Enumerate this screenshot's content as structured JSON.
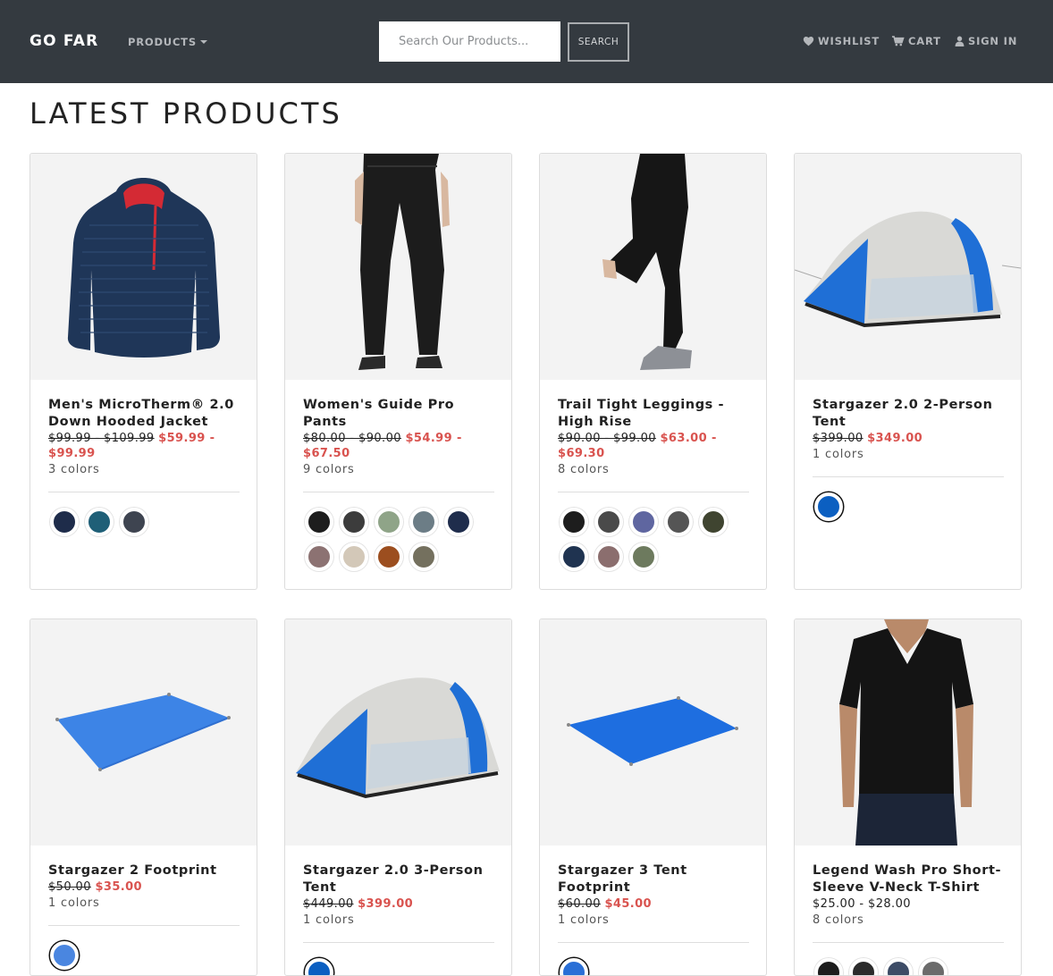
{
  "nav": {
    "brand": "GO FAR",
    "products_label": "PRODUCTS",
    "search_placeholder": "Search Our Products...",
    "search_button": "SEARCH",
    "wishlist": "WISHLIST",
    "cart": "CART",
    "sign_in": "SIGN IN",
    "icons": [
      "heart-icon",
      "cart-icon",
      "user-icon",
      "caret-down-icon"
    ]
  },
  "page_title": "LATEST PRODUCTS",
  "colors": {
    "navbar": "#343a40",
    "sale_price": "#d9534f"
  },
  "products": [
    {
      "title": "Men's MicroTherm® 2.0 Down Hooded Jacket",
      "old_price": "$99.99 - $109.99",
      "price": "$59.99 - $99.99",
      "on_sale": true,
      "colors_label": "3 colors",
      "swatches": [
        "#1e2c4a",
        "#1f5f77",
        "#3e4450"
      ]
    },
    {
      "title": "Women's Guide Pro Pants",
      "old_price": "$80.00 - $90.00",
      "price": "$54.99 - $67.50",
      "on_sale": true,
      "colors_label": "9 colors",
      "swatches": [
        "#1d1d1d",
        "#3c3c3c",
        "#8fa488",
        "#6c7d86",
        "#1f2d4c",
        "#8c7272",
        "#d3c8b8",
        "#9c4e1f",
        "#74705e"
      ]
    },
    {
      "title": "Trail Tight Leggings - High Rise",
      "old_price": "$90.00 - $99.00",
      "price": "$63.00 - $69.30",
      "on_sale": true,
      "colors_label": "8 colors",
      "swatches": [
        "#1d1d1d",
        "#4a4a4a",
        "#5f66a0",
        "#555555",
        "#3f4430",
        "#1f3350",
        "#8b6e6e",
        "#6d7a5e"
      ]
    },
    {
      "title": "Stargazer 2.0 2-Person Tent",
      "old_price": "$399.00",
      "price": "$349.00",
      "on_sale": true,
      "colors_label": "1 colors",
      "swatches": [
        "#0b5fc1"
      ]
    },
    {
      "title": "Stargazer 2 Footprint",
      "old_price": "$50.00",
      "price": "$35.00",
      "on_sale": true,
      "colors_label": "1 colors",
      "swatches": [
        "#4a86e0"
      ]
    },
    {
      "title": "Stargazer 2.0 3-Person Tent",
      "old_price": "$449.00",
      "price": "$399.00",
      "on_sale": true,
      "colors_label": "1 colors",
      "swatches": [
        "#0b5fc1"
      ]
    },
    {
      "title": "Stargazer 3 Tent Footprint",
      "old_price": "$60.00",
      "price": "$45.00",
      "on_sale": true,
      "colors_label": "1 colors",
      "swatches": [
        "#2a6fd6"
      ]
    },
    {
      "title": "Legend Wash Pro Short-Sleeve V-Neck T-Shirt",
      "old_price": "",
      "price": "$25.00 - $28.00",
      "on_sale": false,
      "colors_label": "8 colors",
      "swatches": [
        "#1d1d1d",
        "#2b2b2b",
        "#3d4c66",
        "#6b6b6b"
      ]
    }
  ]
}
